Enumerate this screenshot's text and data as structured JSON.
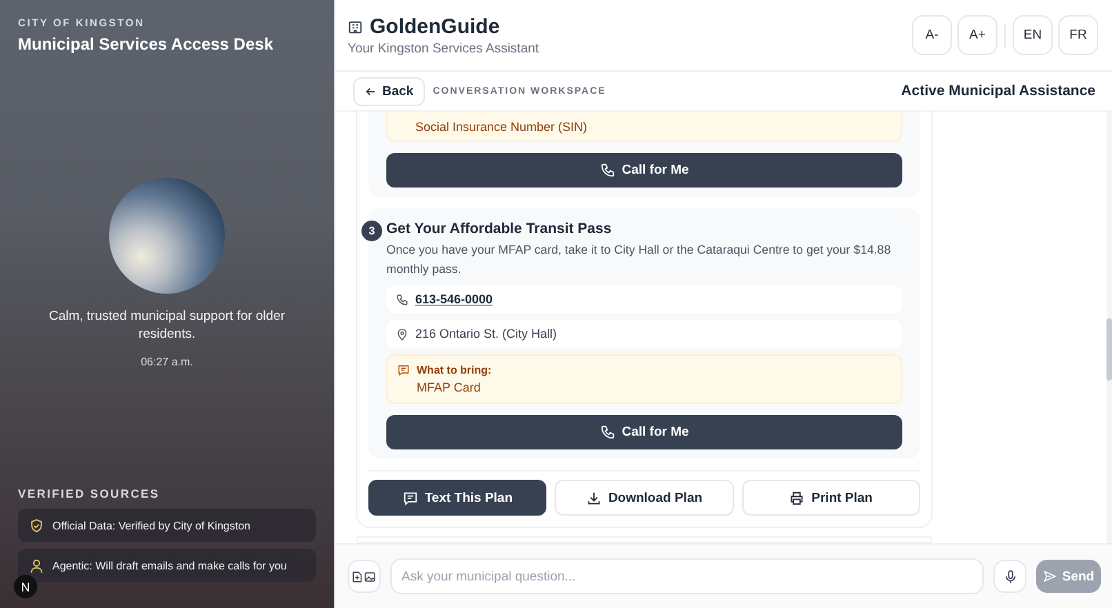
{
  "sidebar": {
    "eyebrow": "CITY OF KINGSTON",
    "title": "Municipal Services Access Desk",
    "tagline": "Calm, trusted municipal support for older residents.",
    "time": "06:27 a.m.",
    "sources_heading": "VERIFIED SOURCES",
    "sources": [
      {
        "kind": "shield",
        "text": "Official Data: Verified by City of Kingston"
      },
      {
        "kind": "agent",
        "text": "Agentic: Will draft emails and make calls for you"
      }
    ],
    "badge": "N"
  },
  "header": {
    "brand": "GoldenGuide",
    "subtitle": "Your Kingston Services Assistant",
    "font_size_controls": [
      "A-",
      "A+"
    ],
    "language_controls": [
      "EN",
      "FR"
    ]
  },
  "subheader": {
    "back": "Back",
    "section": "CONVERSATION WORKSPACE",
    "status": "Active Municipal Assistance"
  },
  "previous_step": {
    "bring_value": "Social Insurance Number (SIN)",
    "call_button": "Call for Me"
  },
  "step": {
    "number": "3",
    "title": "Get Your Affordable Transit Pass",
    "description": "Once you have your MFAP card, take it to City Hall or the Cataraqui Centre to get your $14.88 monthly pass.",
    "phone": "613-546-0000",
    "address": "216 Ontario St. (City Hall)",
    "bring_label": "What to bring:",
    "bring_value": "MFAP Card",
    "call_button": "Call for Me"
  },
  "plan_actions": [
    {
      "kind": "text",
      "label": "Text This Plan",
      "selected": true
    },
    {
      "kind": "download",
      "label": "Download Plan",
      "selected": false
    },
    {
      "kind": "print",
      "label": "Print Plan",
      "selected": false
    }
  ],
  "composer": {
    "placeholder": "Ask your municipal question...",
    "send": "Send",
    "send_disabled": true
  }
}
